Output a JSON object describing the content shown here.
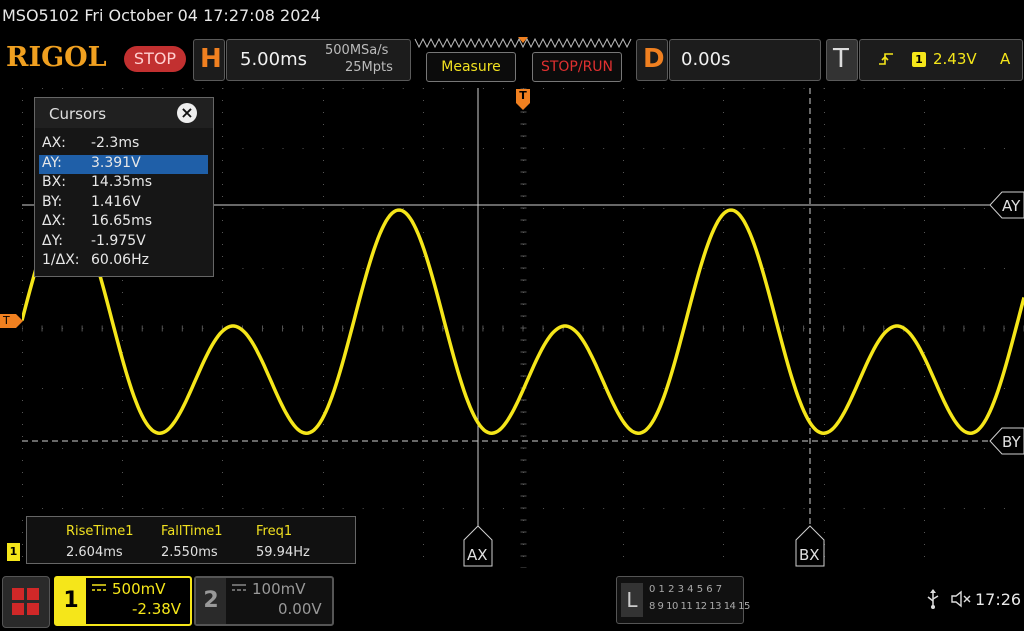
{
  "status": {
    "line": "MSO5102  Fri October 04 17:27:08 2024"
  },
  "toolbar": {
    "brand": "RIGOL",
    "run_state": "STOP",
    "horizontal": {
      "letter": "H",
      "timebase": "5.00ms",
      "sample_rate": "500MSa/s",
      "memory_depth": "25Mpts"
    },
    "measure_label": "Measure",
    "stoprun_label": "STOP/RUN",
    "delay": {
      "letter": "D",
      "value": "0.00s"
    },
    "trigger": {
      "letter": "T",
      "source": "1",
      "level": "2.43V",
      "mode": "A"
    }
  },
  "cursors": {
    "title": "Cursors",
    "close": "×",
    "rows": [
      {
        "k": "AX:",
        "v": "-2.3ms"
      },
      {
        "k": "AY:",
        "v": "3.391V"
      },
      {
        "k": "BX:",
        "v": "14.35ms"
      },
      {
        "k": "BY:",
        "v": "1.416V"
      },
      {
        "k": "ΔX:",
        "v": "16.65ms"
      },
      {
        "k": "ΔY:",
        "v": "-1.975V"
      },
      {
        "k": "1/ΔX:",
        "v": "60.06Hz"
      }
    ],
    "selected_row": 1
  },
  "markers": {
    "ay": "AY",
    "by": "BY",
    "ax": "AX",
    "bx": "BX",
    "trig": "T",
    "ch1": "1"
  },
  "measurements": [
    {
      "name": "RiseTime1",
      "value": "2.604ms"
    },
    {
      "name": "FallTime1",
      "value": "2.550ms"
    },
    {
      "name": "Freq1",
      "value": "59.94Hz"
    }
  ],
  "channels": [
    {
      "num": "1",
      "scale": "500mV",
      "offset": "-2.38V",
      "color": "#f5e61a"
    },
    {
      "num": "2",
      "scale": "100mV",
      "offset": "0.00V",
      "color": "#777777"
    }
  ],
  "logic": {
    "letter": "L",
    "row1": "0 1 2 3  4 5 6 7",
    "row2": "8 9 10 11 12 13 14 15"
  },
  "system": {
    "time": "17:26"
  },
  "colors": {
    "ch1": "#f5e61a",
    "accent": "#f08020",
    "stop": "#c23030",
    "selection": "#1f5fa8"
  }
}
